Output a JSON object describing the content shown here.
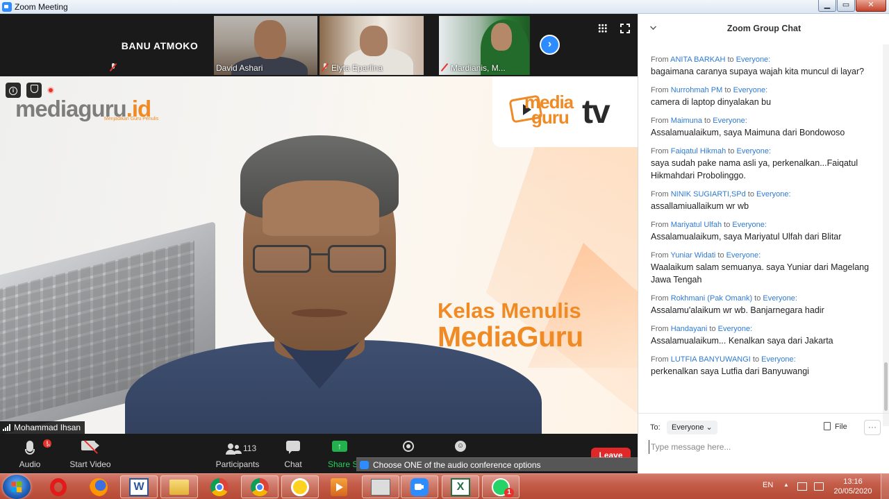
{
  "window": {
    "title": "Zoom Meeting",
    "min": "▁",
    "max": "▭",
    "close": "✕"
  },
  "gallery": {
    "tiles": [
      {
        "name": "BANU ATMOKO"
      },
      {
        "name": "David Ashari"
      },
      {
        "name": "Elyta Eparlina"
      },
      {
        "name": "Mardianis, M..."
      }
    ],
    "next": "›"
  },
  "main_video": {
    "speaker": "Mohammad Ihsan",
    "logo_left": "mediaguru",
    "logo_left_suffix": ".id",
    "logo_tagline": "Menjadikan Guru Penulis",
    "logo_tv_media": "media",
    "logo_tv_guru": "guru",
    "logo_tv_suffix": "tv",
    "banner_line1": "Kelas Menulis",
    "banner_line2": "MediaGuru",
    "info_badge": "i"
  },
  "toolbar": {
    "audio": "Audio",
    "audio_alert": "!",
    "caret": "^",
    "video": "Start Video",
    "participants": "Participants",
    "participants_count": "113",
    "chat": "Chat",
    "share": "Share S",
    "share_glyph": "↑",
    "react_glyph": "☺",
    "leave": "Leave"
  },
  "notification": {
    "text": "Choose ONE of the audio conference options",
    "close": "✕"
  },
  "chat": {
    "title": "Zoom Group Chat",
    "messages": [
      {
        "from": "ANITA BARKAH",
        "to": "Everyone:",
        "text": "bagaimana caranya supaya wajah kita muncul di layar?"
      },
      {
        "from": "Nurrohmah PM",
        "to": "Everyone:",
        "text": "camera di laptop dinyalakan bu"
      },
      {
        "from": "Maimuna",
        "to": "Everyone:",
        "text": "Assalamualaikum, saya Maimuna dari Bondowoso"
      },
      {
        "from": "Faiqatul Hikmah",
        "to": "Everyone:",
        "text": "saya sudah pake nama asli ya, perkenalkan...Faiqatul Hikmahdari  Probolinggo."
      },
      {
        "from": "NINIK SUGIARTI,SPd",
        "to": "Everyone:",
        "text": "assallamiuallaikum wr wb"
      },
      {
        "from": "Mariyatul Ulfah",
        "to": "Everyone:",
        "text": "Assalamualaikum, saya Mariyatul Ulfah dari Blitar"
      },
      {
        "from": "Yuniar Widati",
        "to": "Everyone:",
        "text": "Waalaikum salam semuanya. saya Yuniar dari Magelang Jawa Tengah"
      },
      {
        "from": "Rokhmani (Pak Omank)",
        "to": "Everyone:",
        "text": "Assalamu'alaikum wr wb. Banjarnegara hadir"
      },
      {
        "from": "Handayani",
        "to": "Everyone:",
        "text": "Assalamualaikum... Kenalkan saya dari Jakarta"
      },
      {
        "from": "LUTFIA BANYUWANGI",
        "to": "Everyone:",
        "text": "perkenalkan saya Lutfia dari Banyuwangi"
      }
    ],
    "from_word": "From",
    "to_word": "to",
    "to_label": "To:",
    "to_value": "Everyone",
    "to_caret": "⌄",
    "file_label": "File",
    "more": "···",
    "input_placeholder": "Type message here..."
  },
  "taskbar": {
    "word_letter": "W",
    "excel_letter": "X",
    "whatsapp_badge": "1",
    "lang": "EN",
    "tray_up": "▲",
    "time": "13:16",
    "date": "20/05/2020"
  }
}
